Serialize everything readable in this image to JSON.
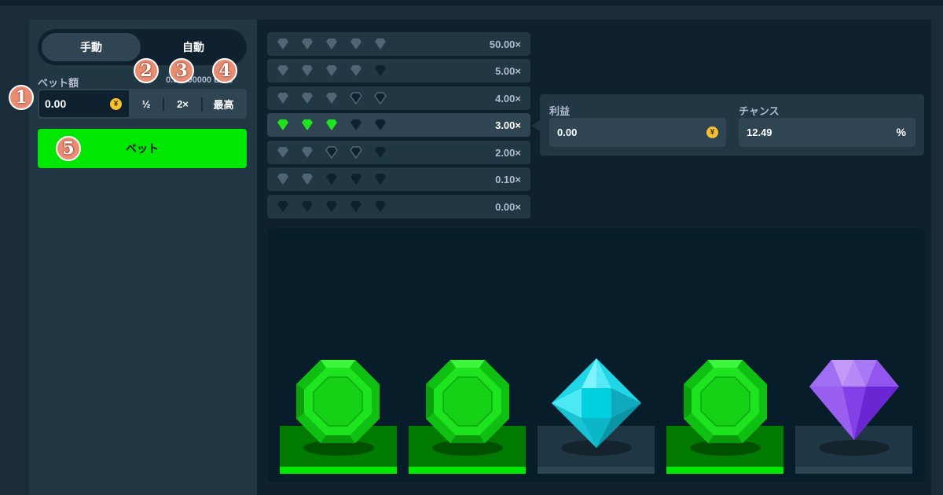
{
  "tabs": {
    "manual": "手動",
    "auto": "自動"
  },
  "bet": {
    "label": "ベット額",
    "balance_text": "0.00000000 BGE",
    "value": "0.00",
    "currency_icon": "yen-coin-icon",
    "half_label": "½",
    "double_label": "2×",
    "max_label": "最高",
    "button_label": "ベット"
  },
  "badges": [
    "1",
    "2",
    "3",
    "4",
    "5"
  ],
  "payout_table": [
    {
      "multiplier": "50.00×",
      "gems": [
        "gray",
        "gray",
        "gray",
        "gray",
        "gray"
      ]
    },
    {
      "multiplier": "5.00×",
      "gems": [
        "gray",
        "gray",
        "gray",
        "gray",
        "dark"
      ]
    },
    {
      "multiplier": "4.00×",
      "gems": [
        "gray",
        "gray",
        "gray",
        "outline",
        "outline"
      ]
    },
    {
      "multiplier": "3.00×",
      "gems": [
        "green",
        "green",
        "green",
        "dark",
        "dark"
      ],
      "selected": true
    },
    {
      "multiplier": "2.00×",
      "gems": [
        "gray",
        "gray",
        "outline",
        "outline",
        "dark"
      ]
    },
    {
      "multiplier": "0.10×",
      "gems": [
        "gray",
        "gray",
        "dark",
        "dark",
        "dark"
      ]
    },
    {
      "multiplier": "0.00×",
      "gems": [
        "dark",
        "dark",
        "dark",
        "dark",
        "dark"
      ]
    }
  ],
  "info": {
    "profit_label": "利益",
    "profit_value": "0.00",
    "chance_label": "チャンス",
    "chance_value": "12.49",
    "chance_unit": "%"
  },
  "colors": {
    "accent_green": "#00e701",
    "panel": "#213743",
    "background": "#1a2c38",
    "badge": "#e98c74"
  },
  "result_gems": [
    {
      "type": "emerald",
      "matched": true
    },
    {
      "type": "emerald",
      "matched": true
    },
    {
      "type": "cyan-diamond",
      "matched": false
    },
    {
      "type": "emerald",
      "matched": true
    },
    {
      "type": "purple-diamond",
      "matched": false
    }
  ]
}
